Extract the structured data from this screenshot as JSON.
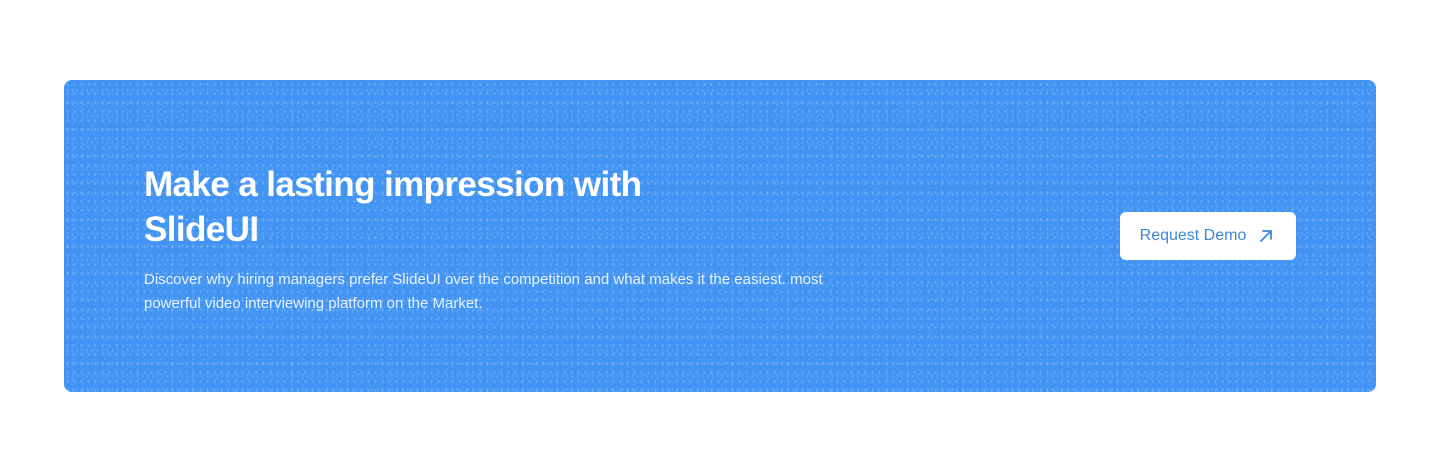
{
  "cta": {
    "heading": "Make a lasting impression with SlideUI",
    "description": "Discover why hiring managers prefer SlideUI over the competition and what makes it the easiest. most powerful video interviewing platform on the Market.",
    "button_label": "Request Demo",
    "button_icon": "arrow-up-right-icon"
  },
  "colors": {
    "background": "#ffffff",
    "banner": "#4294f4",
    "heading_text": "#ffffff",
    "button_background": "#ffffff",
    "button_text": "#3c87d8"
  }
}
